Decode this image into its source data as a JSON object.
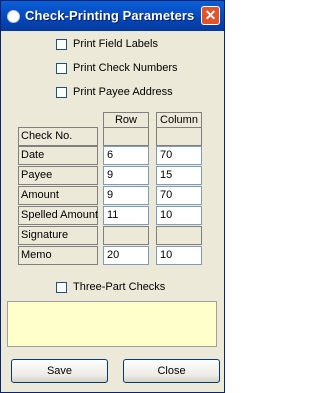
{
  "window": {
    "title": "Check-Printing Parameters",
    "close_glyph": "✕"
  },
  "options": [
    {
      "label": "Print Field Labels",
      "checked": false
    },
    {
      "label": "Print Check Numbers",
      "checked": false
    },
    {
      "label": "Print Payee Address",
      "checked": false
    }
  ],
  "table": {
    "headers": {
      "row": "Row",
      "column": "Column"
    },
    "rows": [
      {
        "label": "Check No.",
        "row": "",
        "column": "",
        "editable": false
      },
      {
        "label": "Date",
        "row": "6",
        "column": "70",
        "editable": true
      },
      {
        "label": "Payee",
        "row": "9",
        "column": "15",
        "editable": true
      },
      {
        "label": "Amount",
        "row": "9",
        "column": "70",
        "editable": true
      },
      {
        "label": "Spelled Amount",
        "row": "11",
        "column": "10",
        "editable": true
      },
      {
        "label": "Signature",
        "row": "",
        "column": "",
        "editable": false
      },
      {
        "label": "Memo",
        "row": "20",
        "column": "10",
        "editable": true
      }
    ]
  },
  "three_part": {
    "label": "Three-Part Checks",
    "checked": false
  },
  "buttons": {
    "save": "Save",
    "close": "Close"
  },
  "colors": {
    "titlebar": "#0a5fd8",
    "info_box": "#ffffcc",
    "window_bg": "#ece9d8"
  }
}
